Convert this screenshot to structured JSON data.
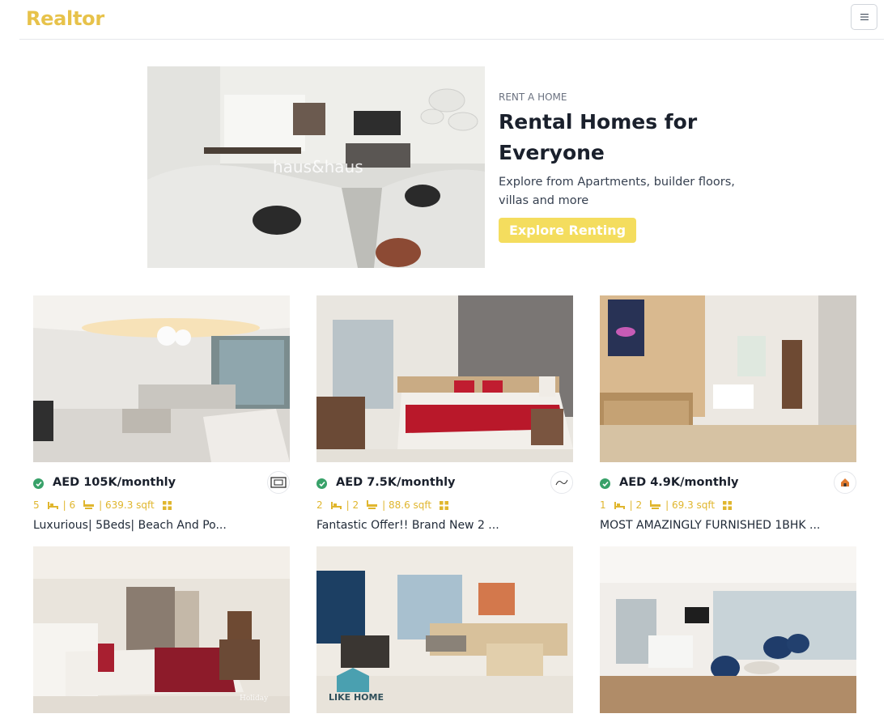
{
  "header": {
    "brand": "Realtor",
    "menu_icon": "hamburger-icon",
    "brand_color": "#e7c24a"
  },
  "hero": {
    "eyebrow": "RENT A HOME",
    "title": "Rental Homes for Everyone",
    "description": "Explore from Apartments, builder floors, villas and more",
    "cta_label": "Explore Renting",
    "cta_color": "#f4dd5e"
  },
  "listings": [
    {
      "price": "AED 105K/monthly",
      "beds": "5",
      "baths": "| 6",
      "area": "| 639.3 sqft",
      "title": "Luxurious| 5Beds| Beach And Po..."
    },
    {
      "price": "AED 7.5K/monthly",
      "beds": "2",
      "baths": "| 2",
      "area": "| 88.6 sqft",
      "title": "Fantastic Offer!! Brand New 2 ..."
    },
    {
      "price": "AED 4.9K/monthly",
      "beds": "1",
      "baths": "| 2",
      "area": "| 69.3 sqft",
      "title": "MOST AMAZINGLY FURNISHED 1BHK ..."
    },
    {
      "price": "",
      "beds": "",
      "baths": "",
      "area": "",
      "title": ""
    },
    {
      "price": "",
      "beds": "",
      "baths": "",
      "area": "",
      "title": ""
    },
    {
      "price": "",
      "beds": "",
      "baths": "",
      "area": "",
      "title": ""
    }
  ],
  "colors": {
    "accent": "#e0b62e",
    "verified": "#38a169"
  }
}
